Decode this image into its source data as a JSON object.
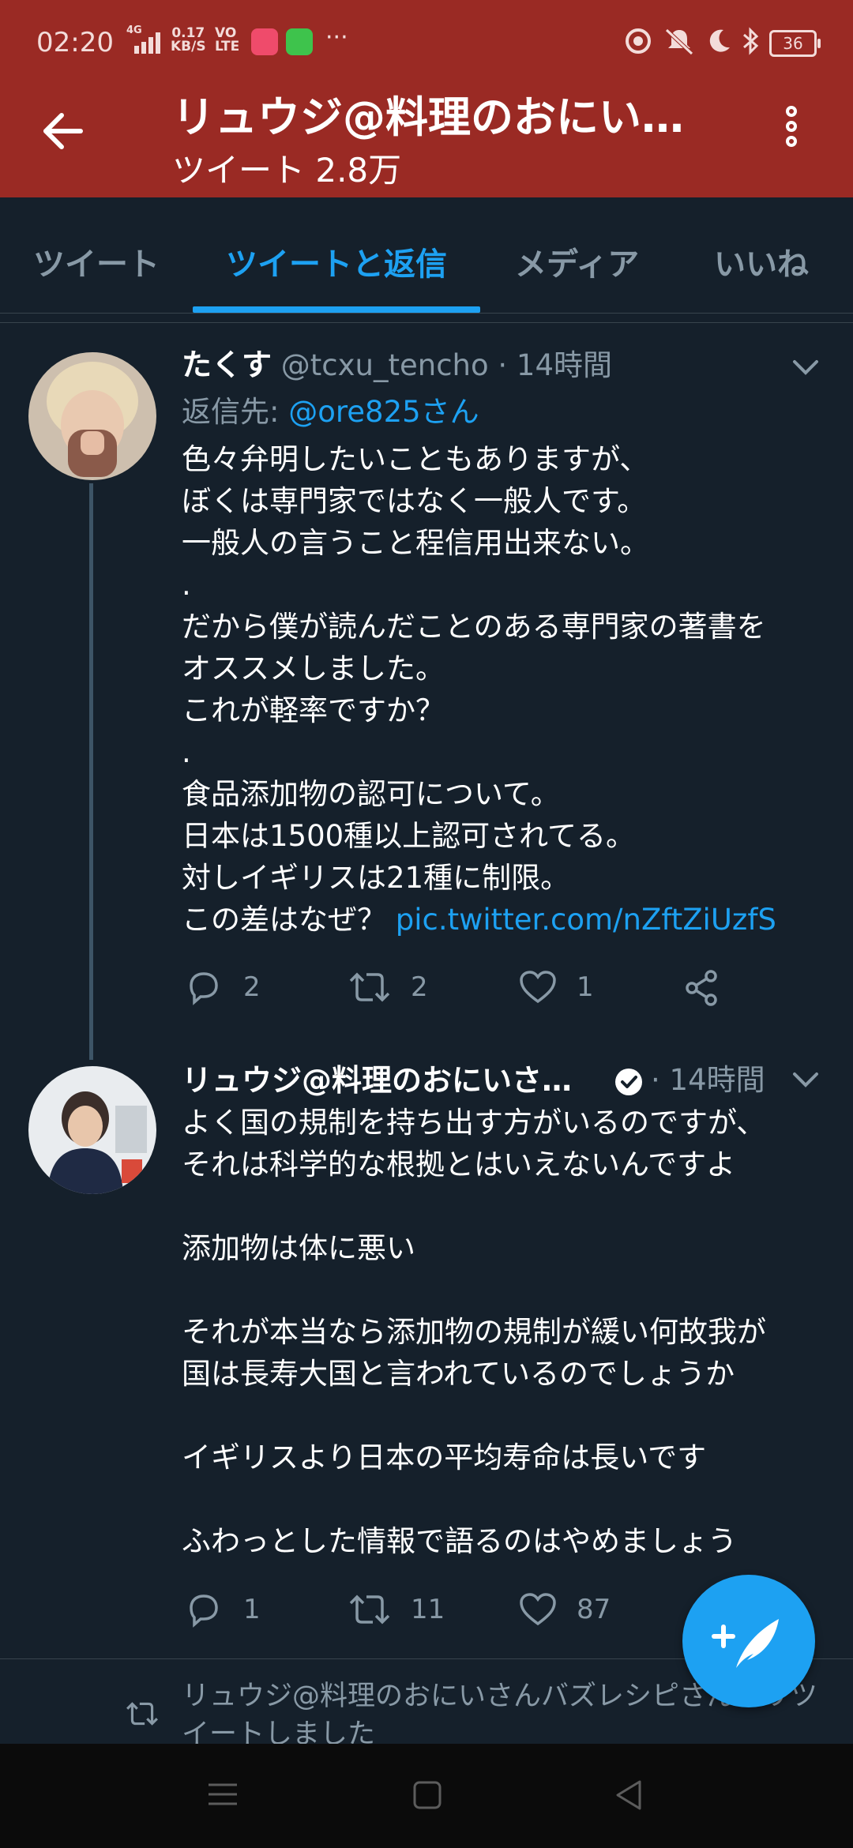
{
  "status_bar": {
    "time": "02:20",
    "network": "4G",
    "speed_value": "0.17",
    "speed_unit": "KB/S",
    "volte_top": "VO",
    "volte_bottom": "LTE",
    "more": "···",
    "battery": "36"
  },
  "header": {
    "title": "リュウジ@料理のおにい…",
    "subtitle": "ツイート 2.8万"
  },
  "tabs": [
    {
      "label": "ツイート",
      "active": false
    },
    {
      "label": "ツイートと返信",
      "active": true
    },
    {
      "label": "メディア",
      "active": false
    },
    {
      "label": "いいね",
      "active": false
    }
  ],
  "tweet1": {
    "display_name": "たくす",
    "handle": "@tcxu_tencho",
    "time": "· 14時間",
    "reply_prefix": "返信先: ",
    "reply_to": "@ore825さん",
    "lines": [
      "色々弁明したいこともありますが、",
      "ぼくは専門家ではなく一般人です。",
      "一般人の言うこと程信用出来ない。",
      ".",
      "だから僕が読んだことのある専門家の著書を",
      "オススメしました。",
      "これが軽率ですか？",
      ".",
      "食品添加物の認可について。",
      "日本は1500種以上認可されてる。",
      "対しイギリスは21種に制限。"
    ],
    "last_line_text": "この差はなぜ？ ",
    "last_line_link": "pic.twitter.com/nZftZiUzfS",
    "replies": "2",
    "retweets": "2",
    "likes": "1"
  },
  "tweet2": {
    "display_name": "リュウジ@料理のおにいさ…",
    "time": "· 14時間",
    "lines": [
      "よく国の規制を持ち出す方がいるのですが、",
      "それは科学的な根拠とはいえないんですよ",
      "",
      "添加物は体に悪い",
      "",
      "それが本当なら添加物の規制が緩い何故我が",
      "国は長寿大国と言われているのでしょうか",
      "",
      "イギリスより日本の平均寿命は長いです",
      "",
      "ふわっとした情報で語るのはやめましょう"
    ],
    "replies": "1",
    "retweets": "11",
    "likes": "87"
  },
  "retweet_notice": {
    "line1": "リュウジ@料理のおにいさんバズレシピさんがリツ",
    "line2": "イートしました"
  },
  "colors": {
    "header_bg": "#9a2a24",
    "background": "#15202b",
    "accent": "#1da1f2",
    "muted": "#8899a6"
  }
}
